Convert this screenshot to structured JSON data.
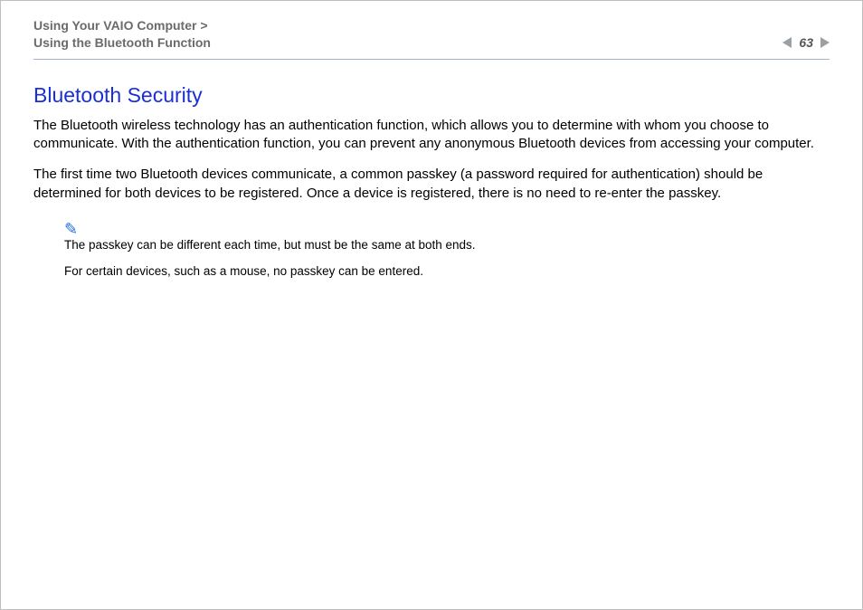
{
  "header": {
    "breadcrumb_line1": "Using Your VAIO Computer >",
    "breadcrumb_line2": "Using the Bluetooth Function",
    "page_number": "63"
  },
  "content": {
    "title": "Bluetooth Security",
    "para1": "The Bluetooth wireless technology has an authentication function, which allows you to determine with whom you choose to communicate. With the authentication function, you can prevent any anonymous Bluetooth devices from accessing your computer.",
    "para2": "The first time two Bluetooth devices communicate, a common passkey (a password required for authentication) should be determined for both devices to be registered. Once a device is registered, there is no need to re-enter the passkey.",
    "note1": "The passkey can be different each time, but must be the same at both ends.",
    "note2": "For certain devices, such as a mouse, no passkey can be entered."
  }
}
